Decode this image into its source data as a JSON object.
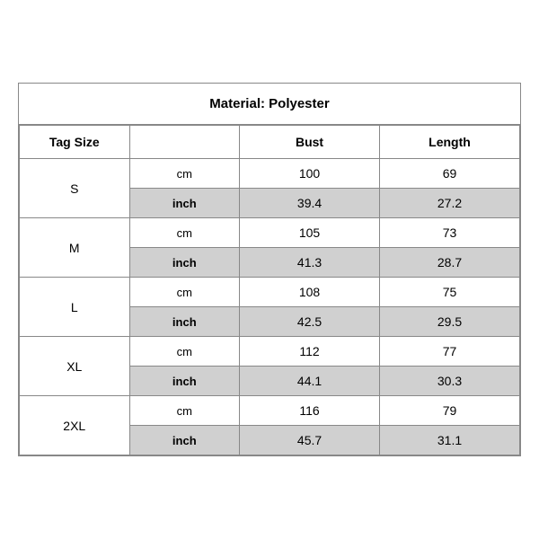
{
  "title": "Material: Polyester",
  "headers": {
    "tag_size": "Tag Size",
    "bust": "Bust",
    "length": "Length"
  },
  "sizes": [
    {
      "size": "S",
      "cm": {
        "bust": "100",
        "length": "69"
      },
      "inch": {
        "bust": "39.4",
        "length": "27.2"
      }
    },
    {
      "size": "M",
      "cm": {
        "bust": "105",
        "length": "73"
      },
      "inch": {
        "bust": "41.3",
        "length": "28.7"
      }
    },
    {
      "size": "L",
      "cm": {
        "bust": "108",
        "length": "75"
      },
      "inch": {
        "bust": "42.5",
        "length": "29.5"
      }
    },
    {
      "size": "XL",
      "cm": {
        "bust": "112",
        "length": "77"
      },
      "inch": {
        "bust": "44.1",
        "length": "30.3"
      }
    },
    {
      "size": "2XL",
      "cm": {
        "bust": "116",
        "length": "79"
      },
      "inch": {
        "bust": "45.7",
        "length": "31.1"
      }
    }
  ],
  "unit_labels": {
    "cm": "cm",
    "inch": "inch"
  }
}
